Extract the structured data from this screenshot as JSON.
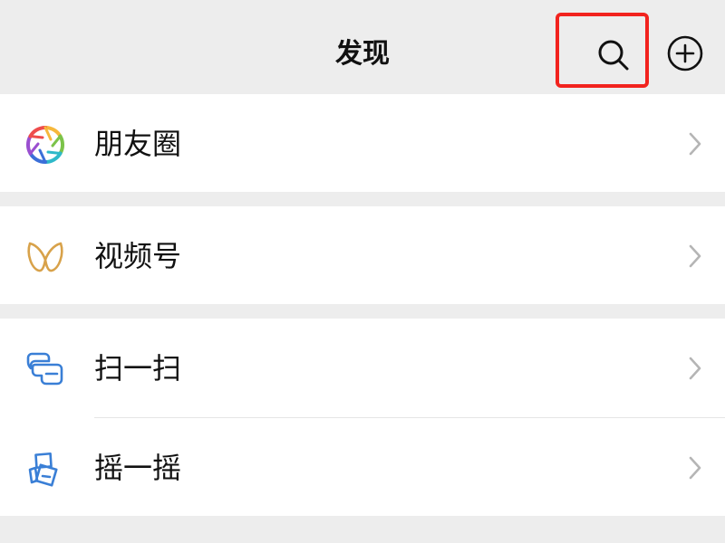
{
  "header": {
    "title": "发现",
    "search_icon": "search-icon",
    "add_icon": "plus-circle-icon"
  },
  "menu": [
    {
      "label": "朋友圈",
      "icon": "moments-aperture-icon"
    },
    {
      "label": "视频号",
      "icon": "channels-butterfly-icon"
    },
    {
      "label": "扫一扫",
      "icon": "scan-icon"
    },
    {
      "label": "摇一摇",
      "icon": "shake-icon"
    }
  ],
  "colors": {
    "background": "#ededed",
    "row_background": "#ffffff",
    "highlight_border": "#f2231e",
    "chevron": "#b5b5b5",
    "channels_gold": "#d8a24a",
    "scan_blue": "#3a7fd6"
  }
}
